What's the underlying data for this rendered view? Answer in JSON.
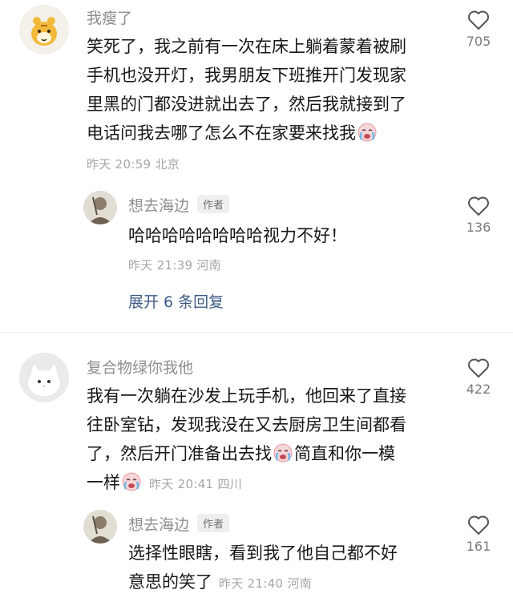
{
  "comments": [
    {
      "username": "我瘦了",
      "lines": [
        "笑死了，我之前有一次在床上躺着蒙着被刷",
        "手机也没开灯，我男朋友下班推开门发现家",
        "里黑的门都没进就出去了，然后我就接到了",
        "电话问我去哪了怎么不在家要来找我"
      ],
      "meta": "昨天 20:59 北京",
      "likes": "705",
      "reply": {
        "username": "想去海边",
        "author_tag": "作者",
        "text": "哈哈哈哈哈哈哈哈视力不好！",
        "meta": "昨天 21:39 河南",
        "likes": "136"
      },
      "expand_label": "展开 6 条回复"
    },
    {
      "username": "复合物绿你我他",
      "lines": [
        "我有一次躺在沙发上玩手机，他回来了直接",
        "往卧室钻，发现我没在又去厨房卫生间都看",
        "了，然后开门准备出去找",
        "简直和你一模",
        "一样"
      ],
      "meta": "昨天 20:41 四川",
      "likes": "422",
      "reply": {
        "username": "想去海边",
        "author_tag": "作者",
        "lines": [
          "选择性眼瞎，看到我了他自己都不好",
          "意思的笑了"
        ],
        "meta": "昨天 21:40 河南",
        "likes": "161"
      }
    }
  ],
  "colors": {
    "text": "#161616",
    "name": "#8e8e8e",
    "meta": "#a6a6a6",
    "link": "#3d5a86"
  },
  "icons": {
    "like": "heart-outline-icon",
    "emoji": "crying-face-emoji-icon"
  }
}
